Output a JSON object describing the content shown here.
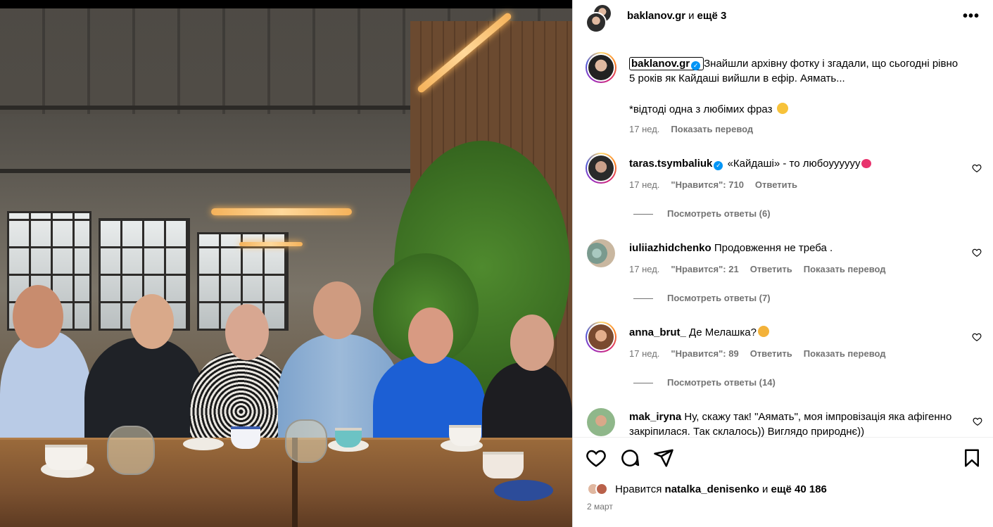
{
  "post": {
    "author": "baklanov.gr",
    "header_and": "и",
    "header_more": "ещё 3",
    "caption_line1": "Знайшли архівну фотку і згадали, що сьогодні рівно 5 років як Кайдаші вийшли в ефір. Аямать...",
    "caption_line2": "*відтоді одна з любімих фраз",
    "caption_time": "17 нед.",
    "caption_translate": "Показать перевод",
    "photo_alt": "photo"
  },
  "comments": [
    {
      "user": "taras.tsymbaliuk",
      "verified": true,
      "text": "«Кайдаші» - то любоуууууу",
      "time": "17 нед.",
      "likes": "\"Нравится\": 710",
      "reply": "Ответить",
      "translate": "",
      "replies": "Посмотреть ответы (6)"
    },
    {
      "user": "iuliiazhidchenko",
      "verified": false,
      "text": "Продовження не треба .",
      "time": "17 нед.",
      "likes": "\"Нравится\": 21",
      "reply": "Ответить",
      "translate": "Показать перевод",
      "replies": "Посмотреть ответы (7)"
    },
    {
      "user": "anna_brut_",
      "verified": false,
      "text": "Де Мелашка?",
      "time": "17 нед.",
      "likes": "\"Нравится\": 89",
      "reply": "Ответить",
      "translate": "Показать перевод",
      "replies": "Посмотреть ответы (14)"
    },
    {
      "user": "mak_iryna",
      "verified": false,
      "text": "Ну, скажу так! \"Аямать\", моя імпровізація яка афігенно закріпилася. Так склалось)) Виглядо природнє))",
      "time": "",
      "likes": "",
      "reply": "",
      "translate": "",
      "replies": ""
    }
  ],
  "footer": {
    "likes_prefix": "Нравится",
    "likes_user": "natalka_denisenko",
    "likes_and": "и",
    "likes_more": "ещё 40 186",
    "date": "2 март"
  },
  "icons": {
    "more": "more-horizontal-icon",
    "like": "heart-icon",
    "comment": "comment-icon",
    "share": "share-icon",
    "save": "bookmark-icon",
    "verified": "verified-badge-icon"
  },
  "colors": {
    "verified": "#0095f6",
    "muted": "#737373",
    "heart_emoji": "#e8336d"
  }
}
